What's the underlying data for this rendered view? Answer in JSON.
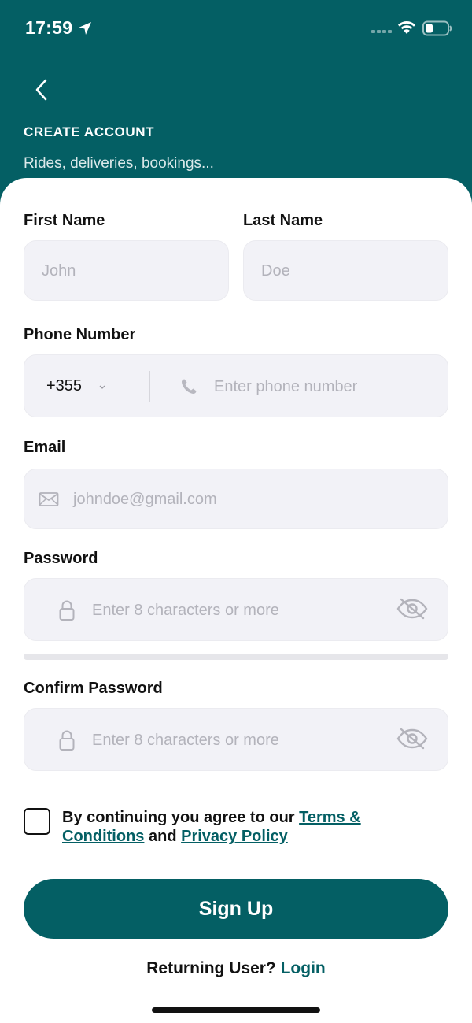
{
  "status_bar": {
    "time": "17:59"
  },
  "header": {
    "title": "CREATE ACCOUNT",
    "subtitle": "Rides, deliveries, bookings..."
  },
  "form": {
    "first_name": {
      "label": "First Name",
      "placeholder": "John",
      "value": ""
    },
    "last_name": {
      "label": "Last Name",
      "placeholder": "Doe",
      "value": ""
    },
    "phone": {
      "label": "Phone Number",
      "country_code": "+355",
      "placeholder": "Enter phone number",
      "value": ""
    },
    "email": {
      "label": "Email",
      "placeholder": "johndoe@gmail.com",
      "value": ""
    },
    "password": {
      "label": "Password",
      "placeholder": "Enter 8 characters or more",
      "value": ""
    },
    "confirm_password": {
      "label": "Confirm Password",
      "placeholder": "Enter 8 characters or more",
      "value": ""
    }
  },
  "terms": {
    "checked": false,
    "prefix": "By continuing you agree to our ",
    "terms_link": "Terms & Conditions",
    "middle": " and ",
    "privacy_link": "Privacy Policy"
  },
  "actions": {
    "signup_label": "Sign Up",
    "returning_prefix": "Returning User? ",
    "login_label": "Login"
  },
  "colors": {
    "brand": "#045f64",
    "field_bg": "#f2f2f7",
    "placeholder": "#b3b3bb"
  },
  "icons": [
    "location-arrow-icon",
    "wifi-icon",
    "battery-icon",
    "back-chevron-icon",
    "chevron-down-icon",
    "phone-icon",
    "mail-icon",
    "lock-icon",
    "eye-slash-icon"
  ]
}
